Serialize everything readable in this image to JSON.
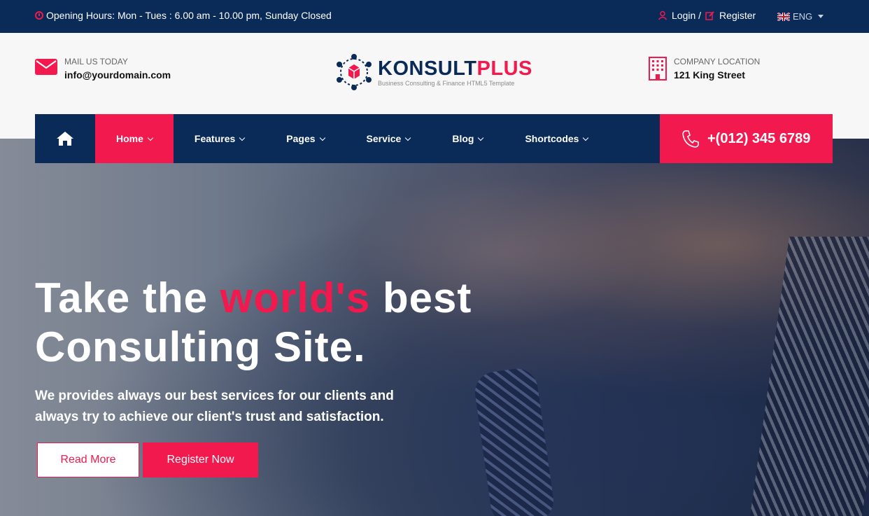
{
  "topbar": {
    "hours": "Opening Hours: Mon - Tues : 6.00 am - 10.00 pm, Sunday Closed",
    "login": "Login /",
    "register": "Register",
    "language": "ENG"
  },
  "header": {
    "mail_label": "MAIL US TODAY",
    "mail_value": "info@yourdomain.com",
    "logo_part1": "KONSULT",
    "logo_part2": "PLUS",
    "logo_tagline": "Business Consulting & Finance HTML5 Template",
    "location_label": "COMPANY LOCATION",
    "location_value": "121 King Street"
  },
  "nav": {
    "items": [
      {
        "label": "Home"
      },
      {
        "label": "Features"
      },
      {
        "label": "Pages"
      },
      {
        "label": "Service"
      },
      {
        "label": "Blog"
      },
      {
        "label": "Shortcodes"
      }
    ],
    "phone": "+(012) 345 6789"
  },
  "hero": {
    "title_1": "Take the ",
    "title_accent": "world's",
    "title_2": " best",
    "title_3": "Consulting Site.",
    "subtitle": "We provides always our best services for our clients and always try to achieve our client's trust and satisfaction.",
    "read_more": "Read More",
    "register_now": "Register Now"
  },
  "colors": {
    "navy": "#0a2b58",
    "accent": "#f1194e"
  },
  "icons": [
    "clock-icon",
    "user-icon",
    "edit-icon",
    "uk-flag-icon",
    "envelope-icon",
    "building-icon",
    "home-icon",
    "phone-icon"
  ]
}
